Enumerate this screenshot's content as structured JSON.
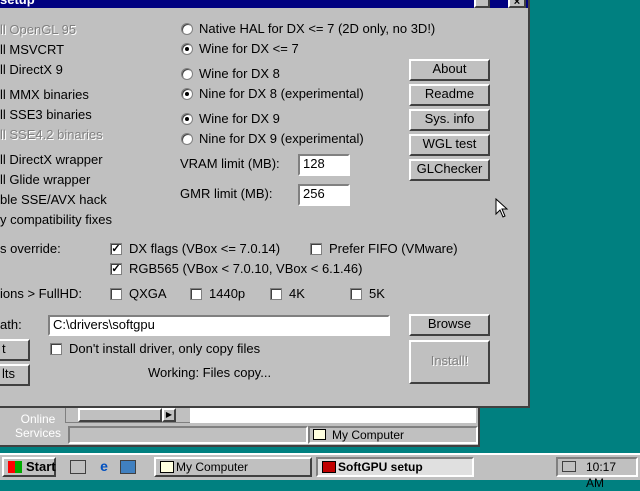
{
  "dialog": {
    "title": "setup",
    "left_options": [
      {
        "label": "ll OpenGL 95",
        "disabled": true
      },
      {
        "label": "ll MSVCRT",
        "disabled": false
      },
      {
        "label": "ll DirectX 9",
        "disabled": false
      },
      {
        "label": "ll MMX binaries",
        "disabled": false
      },
      {
        "label": "ll SSE3 binaries",
        "disabled": false
      },
      {
        "label": "ll SSE4.2 binaries",
        "disabled": true
      },
      {
        "label": "ll DirectX wrapper",
        "disabled": false
      },
      {
        "label": "ll Glide wrapper",
        "disabled": false
      },
      {
        "label": "ble SSE/AVX hack",
        "disabled": false
      },
      {
        "label": "y compatibility fixes",
        "disabled": false
      }
    ],
    "radios": [
      {
        "label": "Native HAL for DX <= 7 (2D only, no 3D!)",
        "checked": false
      },
      {
        "label": "Wine for DX <= 7",
        "checked": true
      },
      {
        "label": "Wine for DX 8",
        "checked": false
      },
      {
        "label": "Nine for DX 8 (experimental)",
        "checked": true
      },
      {
        "label": "Wine for DX 9",
        "checked": true
      },
      {
        "label": "Nine for DX 9 (experimental)",
        "checked": false
      }
    ],
    "vram": {
      "label": "VRAM limit (MB):",
      "value": "128"
    },
    "gmr": {
      "label": "GMR limit (MB):",
      "value": "256"
    },
    "buttons": {
      "about": "About",
      "readme": "Readme",
      "sysinfo": "Sys. info",
      "wgl": "WGL test",
      "glchecker": "GLChecker",
      "browse": "Browse",
      "install": "Install!"
    },
    "override_label": "s override:",
    "dx_flags": {
      "label": "DX flags (VBox <= 7.0.14)",
      "checked": true
    },
    "prefer_fifo": {
      "label": "Prefer FIFO (VMware)",
      "checked": false
    },
    "rgb565": {
      "label": "RGB565 (VBox < 7.0.10, VBox < 6.1.46)",
      "checked": true
    },
    "fullhd_label": "ions > FullHD:",
    "resolutions": [
      {
        "label": "QXGA",
        "checked": false
      },
      {
        "label": "1440p",
        "checked": false
      },
      {
        "label": "4K",
        "checked": false
      },
      {
        "label": "5K",
        "checked": false
      }
    ],
    "path_label": "ath:",
    "path_value": "C:\\drivers\\softgpu",
    "left_btn_1": "t",
    "left_btn_2": "lts",
    "copy_only": {
      "label": "Don't install driver, only copy files",
      "checked": false
    },
    "status": "Working: Files copy..."
  },
  "background_window": {
    "status_label": "My Computer",
    "desktop_icon": "Online Services"
  },
  "taskbar": {
    "start": "Start",
    "tasks": [
      {
        "label": "My Computer",
        "active": false
      },
      {
        "label": "SoftGPU setup",
        "active": true
      }
    ],
    "clock": "10:17 AM"
  }
}
